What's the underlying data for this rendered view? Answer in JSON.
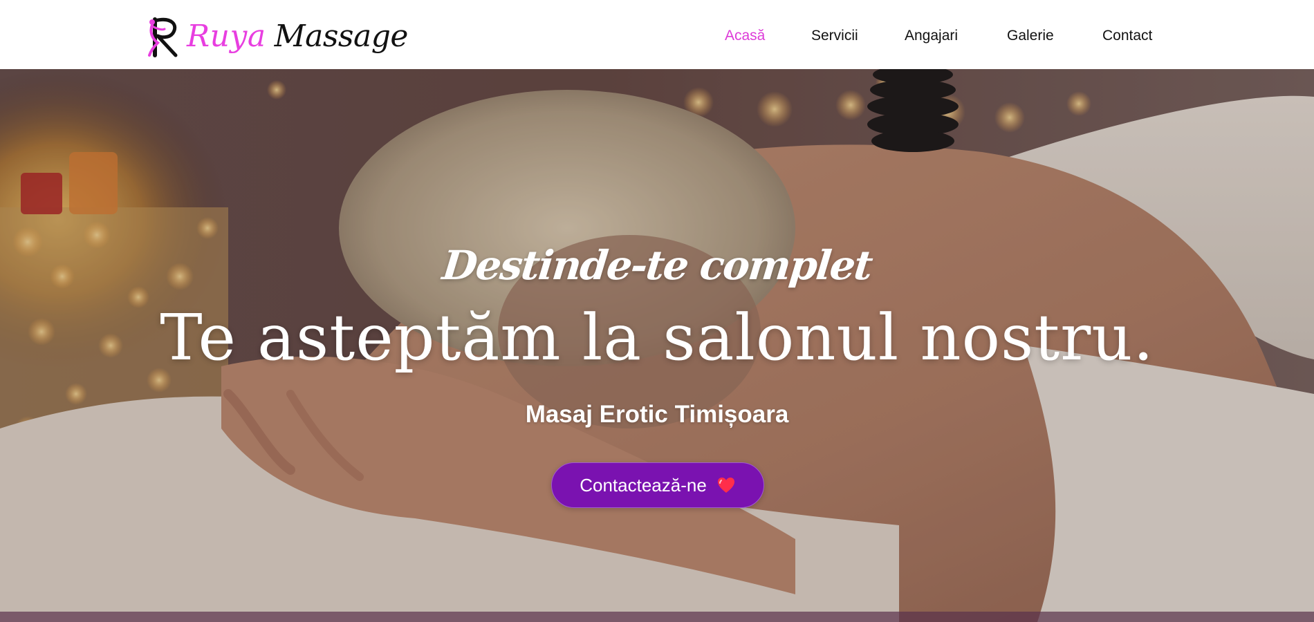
{
  "header": {
    "logo": {
      "word1": "Ruya",
      "word2": "Massage",
      "icon": "ruya-monogram-icon"
    },
    "nav": [
      {
        "label": "Acasă",
        "active": true
      },
      {
        "label": "Servicii",
        "active": false
      },
      {
        "label": "Angajari",
        "active": false
      },
      {
        "label": "Galerie",
        "active": false
      },
      {
        "label": "Contact",
        "active": false
      }
    ]
  },
  "hero": {
    "tagline": "Destinde-te complet",
    "headline": "Te asteptăm la salonul nostru.",
    "subline": "Masaj Erotic Timișoara",
    "cta": {
      "label": "Contactează-ne",
      "icon": "heart-icon"
    },
    "background": "massage-scene-photo"
  },
  "colors": {
    "accent": "#dd3bd8",
    "button": "#7a12b0",
    "text_dark": "#111111",
    "header_bg": "#ffffff"
  }
}
